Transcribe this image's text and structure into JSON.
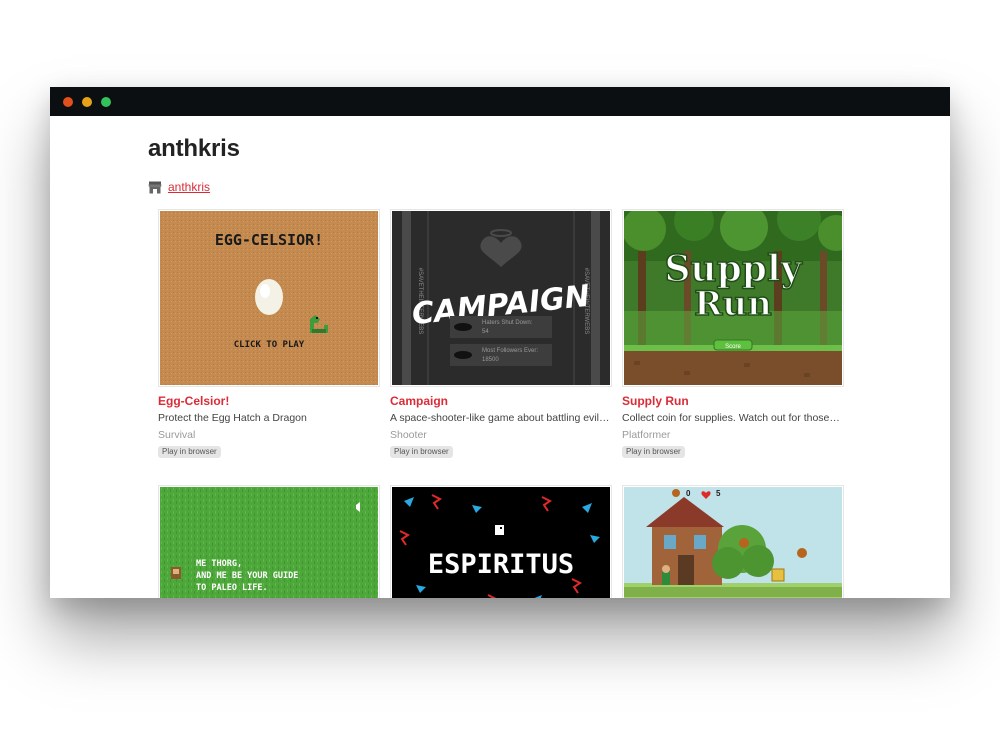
{
  "window": {
    "controls": [
      "close",
      "minimize",
      "maximize"
    ]
  },
  "profile": {
    "title": "anthkris",
    "link_text": "anthkris",
    "link_icon": "store-icon"
  },
  "colors": {
    "accent": "#da2c38",
    "titlebar": "#0c0f12"
  },
  "games": [
    {
      "title": "Egg-Celsior!",
      "description": "Protect the Egg Hatch a Dragon",
      "genre": "Survival",
      "badge": "Play in browser",
      "cover": {
        "heading": "EGG-CELSIOR!",
        "cta": "CLICK TO PLAY"
      }
    },
    {
      "title": "Campaign",
      "description": "A space-shooter-like game about battling evil o...",
      "genre": "Shooter",
      "badge": "Play in browser",
      "cover": {
        "heading": "CAMPAIGN",
        "side_text": "#SAVETHEINTERWEBS",
        "stat1_label": "Haters Shut Down:",
        "stat1_value": "54",
        "stat2_label": "Most Followers Ever:",
        "stat2_value": "18500"
      }
    },
    {
      "title": "Supply Run",
      "description": "Collect coin for supplies. Watch out for those p...",
      "genre": "Platformer",
      "badge": "Play in browser",
      "cover": {
        "heading_line1": "Supply",
        "heading_line2": "Run",
        "button": "Score"
      }
    },
    {
      "title": "",
      "description": "",
      "genre": "",
      "badge": "",
      "cover": {
        "line1": "ME THORG,",
        "line2": "AND ME BE YOUR GUIDE",
        "line3": "TO PALEO LIFE."
      }
    },
    {
      "title": "",
      "description": "",
      "genre": "",
      "badge": "",
      "cover": {
        "heading": "ESPIRITUS"
      }
    },
    {
      "title": "",
      "description": "",
      "genre": "",
      "badge": "",
      "cover": {
        "hud_left": "0",
        "hud_right": "5"
      }
    }
  ]
}
